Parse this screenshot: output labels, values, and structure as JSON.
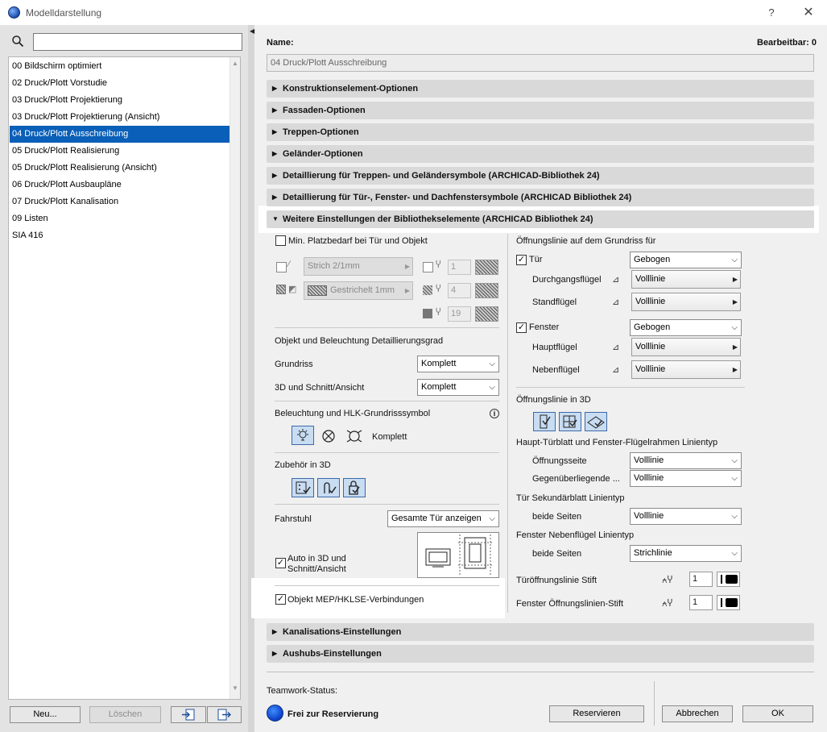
{
  "window": {
    "title": "Modelldarstellung",
    "help": "?",
    "close": "✕"
  },
  "left": {
    "search": {
      "placeholder": ""
    },
    "items": [
      {
        "label": "00 Bildschirm optimiert"
      },
      {
        "label": "02 Druck/Plott Vorstudie"
      },
      {
        "label": "03 Druck/Plott Projektierung"
      },
      {
        "label": "03 Druck/Plott Projektierung (Ansicht)"
      },
      {
        "label": "04 Druck/Plott Ausschreibung"
      },
      {
        "label": "05 Druck/Plott Realisierung"
      },
      {
        "label": "05 Druck/Plott Realisierung (Ansicht)"
      },
      {
        "label": "06 Druck/Plott Ausbaupläne"
      },
      {
        "label": "07 Druck/Plott Kanalisation"
      },
      {
        "label": "09 Listen"
      },
      {
        "label": "SIA 416"
      }
    ],
    "selected_index": 4,
    "buttons": {
      "new": "Neu...",
      "delete": "Löschen"
    }
  },
  "header": {
    "name_label": "Name:",
    "editable": "Bearbeitbar: 0",
    "name_value": "04 Druck/Plott Ausschreibung"
  },
  "sections": [
    {
      "label": "Konstruktionselement-Optionen"
    },
    {
      "label": "Fassaden-Optionen"
    },
    {
      "label": "Treppen-Optionen"
    },
    {
      "label": "Geländer-Optionen"
    },
    {
      "label": "Detaillierung für Treppen- und Geländersymbole (ARCHICAD-Bibliothek 24)"
    },
    {
      "label": "Detaillierung für Tür-, Fenster- und Dachfenstersymbole (ARCHICAD Bibliothek 24)"
    },
    {
      "label": "Weitere Einstellungen der Bibliothekselemente (ARCHICAD Bibliothek 24)"
    },
    {
      "label": "Kanalisations-Einstellungen"
    },
    {
      "label": "Aushubs-Einstellungen"
    }
  ],
  "panel_left": {
    "min_platz": "Min. Platzbedarf bei Tür und Objekt",
    "line_type": "Strich 2/1mm",
    "fill_type": "Gestrichelt 1mm",
    "pen1": "1",
    "pen2": "4",
    "pen3": "19",
    "detail_title": "Objekt und Beleuchtung Detaillierungsgrad",
    "grundriss_label": "Grundriss",
    "grundriss_value": "Komplett",
    "schnitt_label": "3D und Schnitt/Ansicht",
    "schnitt_value": "Komplett",
    "beleuchtung_title": "Beleuchtung und HLK-Grundrisssymbol",
    "info": "i",
    "beleuchtung_value": "Komplett",
    "zubehoer_title": "Zubehör in 3D",
    "fahrstuhl_label": "Fahrstuhl",
    "fahrstuhl_value": "Gesamte Tür anzeigen",
    "auto3d_line1": "Auto in 3D und",
    "auto3d_line2": "Schnitt/Ansicht",
    "mep": "Objekt MEP/HKLSE-Verbindungen"
  },
  "panel_right": {
    "title": "Öffnungslinie auf dem Grundriss für",
    "tuer_label": "Tür",
    "tuer_value": "Gebogen",
    "durchgang_label": "Durchgangsflügel",
    "durchgang_value": "Volllinie",
    "stand_label": "Standflügel",
    "stand_value": "Volllinie",
    "fenster_label": "Fenster",
    "fenster_value": "Gebogen",
    "haupt_label": "Hauptflügel",
    "haupt_value": "Volllinie",
    "neben_label": "Nebenflügel",
    "neben_value": "Volllinie",
    "open3d_title": "Öffnungslinie in 3D",
    "rahmen_title": "Haupt-Türblatt und Fenster-Flügelrahmen Linientyp",
    "oeff_seite_label": "Öffnungsseite",
    "oeff_seite_value": "Volllinie",
    "gegen_label": "Gegenüberliegende ...",
    "gegen_value": "Volllinie",
    "sek_title": "Tür Sekundärblatt Linientyp",
    "beide1_label": "beide Seiten",
    "beide1_value": "Volllinie",
    "fneben_title": "Fenster Nebenflügel Linientyp",
    "beide2_label": "beide Seiten",
    "beide2_value": "Strichlinie",
    "tuerstift_label": "Türöffnungslinie Stift",
    "tuerstift_value": "1",
    "fensterstift_label": "Fenster Öffnungslinien-Stift",
    "fensterstift_value": "1"
  },
  "footer": {
    "teamwork_label": "Teamwork-Status:",
    "status": "Frei zur Reservierung",
    "reserve": "Reservieren",
    "cancel": "Abbrechen",
    "ok": "OK"
  }
}
